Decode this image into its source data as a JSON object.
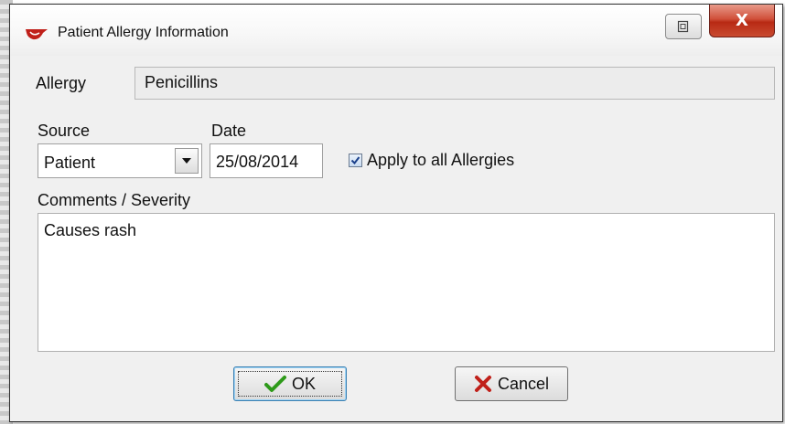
{
  "window": {
    "title": "Patient Allergy Information",
    "close_glyph": "X"
  },
  "fields": {
    "allergy_label": "Allergy",
    "allergy_value": "Penicillins",
    "source_label": "Source",
    "source_value": "Patient",
    "date_label": "Date",
    "date_value": "25/08/2014",
    "apply_all_label": "Apply to all Allergies",
    "apply_all_checked": true,
    "comments_label": "Comments / Severity",
    "comments_value": "Causes rash"
  },
  "buttons": {
    "ok_label": "OK",
    "cancel_label": "Cancel"
  },
  "colors": {
    "ok_check": "#2e9a1a",
    "cancel_x": "#c0201a",
    "close_button": "#c9402a"
  },
  "icons": {
    "title": "app-logo-icon",
    "restore": "restore-icon",
    "close": "close-icon",
    "dropdown": "chevron-down-icon",
    "checkbox": "checkmark-icon",
    "ok": "green-check-icon",
    "cancel": "red-x-icon"
  }
}
